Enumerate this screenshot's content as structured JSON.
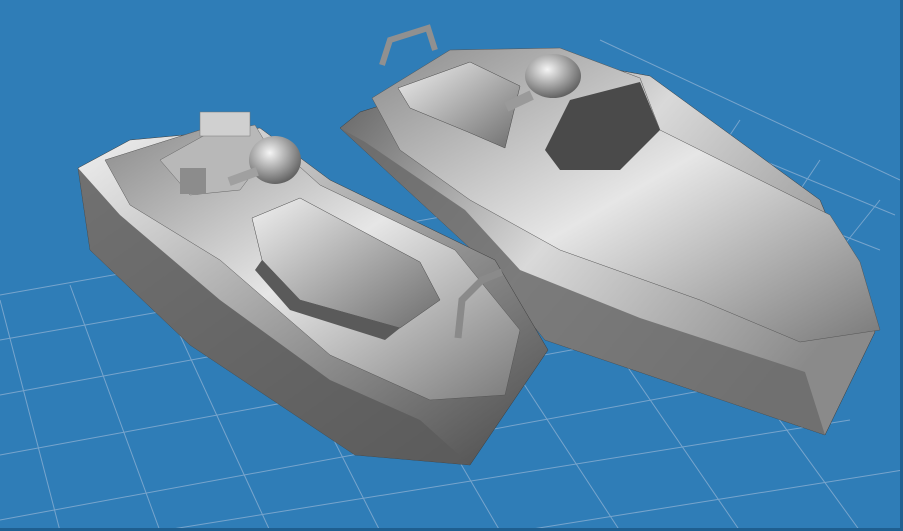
{
  "viewport": {
    "background_color": "#2f7db7",
    "grid_color": "#7fa9cf",
    "model_color": "#c8c8c8",
    "models": [
      {
        "name": "jet-ski-left"
      },
      {
        "name": "jet-ski-right"
      }
    ]
  }
}
